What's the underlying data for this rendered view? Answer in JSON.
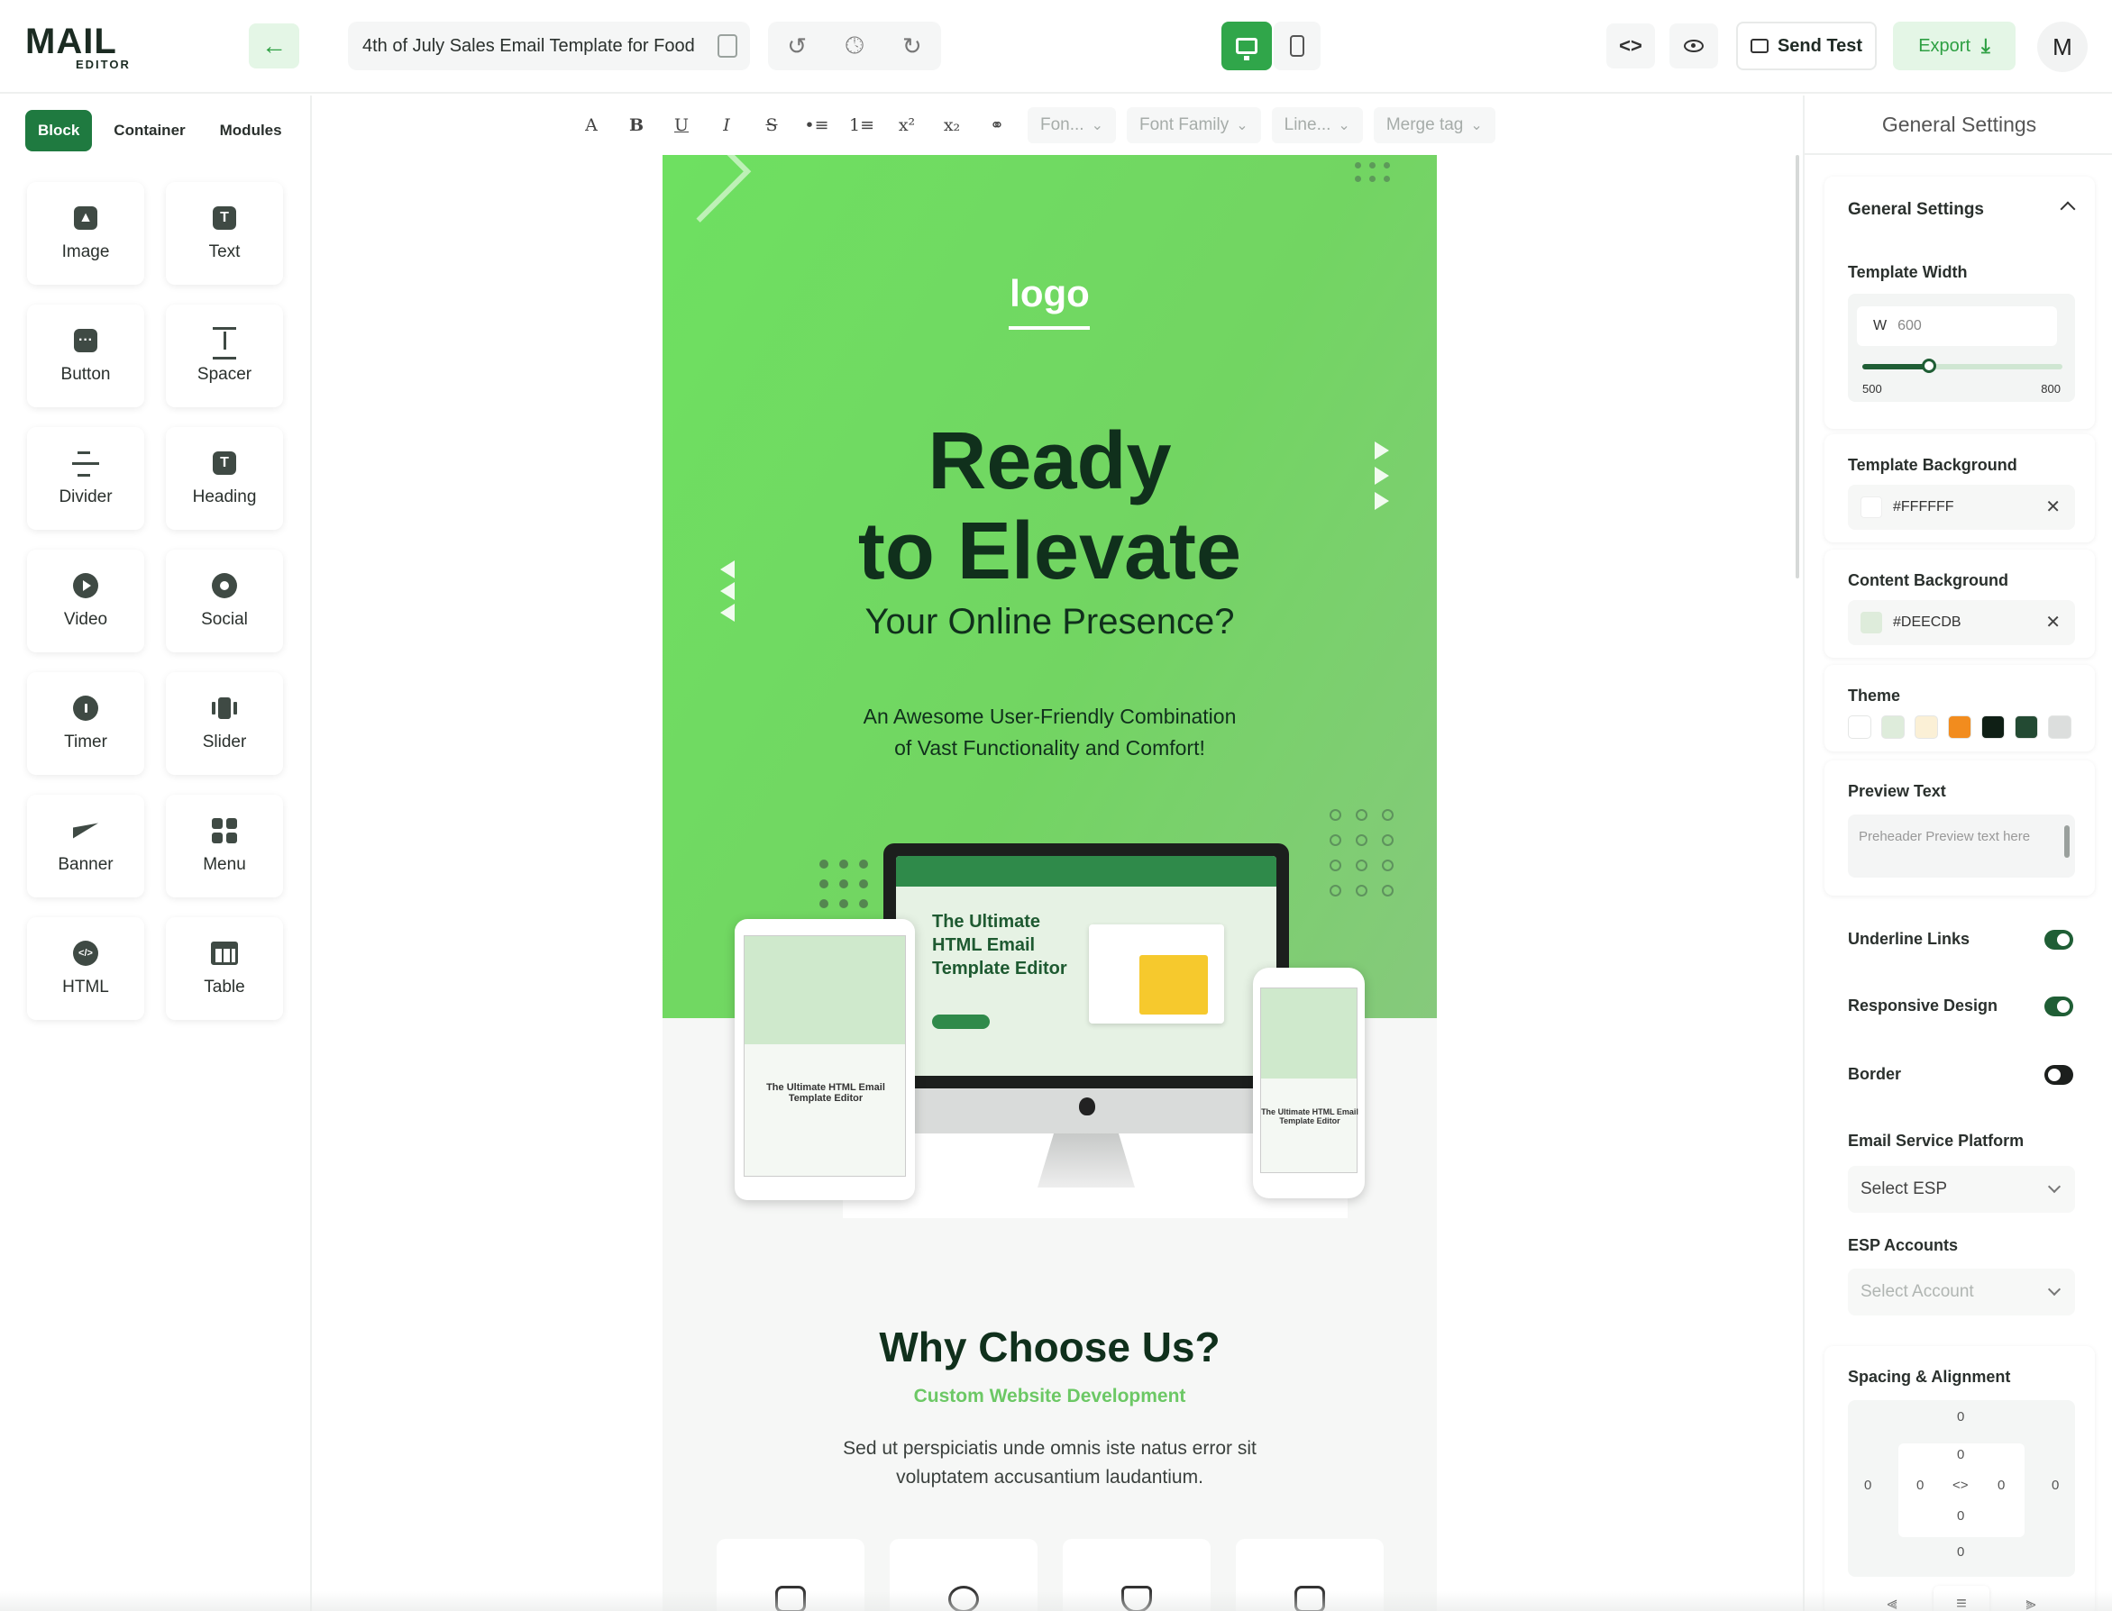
{
  "app": {
    "logo_main": "MAIL",
    "logo_sub": "EDITOR",
    "template_title": "4th of July Sales Email Template for Food",
    "send_test_label": "Send Test",
    "export_label": "Export",
    "avatar_initial": "M"
  },
  "sidebar": {
    "tabs": [
      {
        "label": "Block",
        "active": true
      },
      {
        "label": "Container",
        "active": false
      },
      {
        "label": "Modules",
        "active": false
      }
    ],
    "blocks": [
      {
        "label": "Image",
        "icon": "image-icon"
      },
      {
        "label": "Text",
        "icon": "text-icon"
      },
      {
        "label": "Button",
        "icon": "button-icon"
      },
      {
        "label": "Spacer",
        "icon": "spacer-icon"
      },
      {
        "label": "Divider",
        "icon": "divider-icon"
      },
      {
        "label": "Heading",
        "icon": "heading-icon"
      },
      {
        "label": "Video",
        "icon": "video-icon"
      },
      {
        "label": "Social",
        "icon": "social-icon"
      },
      {
        "label": "Timer",
        "icon": "timer-icon"
      },
      {
        "label": "Slider",
        "icon": "slider-icon"
      },
      {
        "label": "Banner",
        "icon": "banner-icon"
      },
      {
        "label": "Menu",
        "icon": "menu-icon"
      },
      {
        "label": "HTML",
        "icon": "html-icon"
      },
      {
        "label": "Table",
        "icon": "table-icon"
      }
    ]
  },
  "format_toolbar": {
    "buttons": [
      "A",
      "B",
      "U",
      "I",
      "S",
      "•≡",
      "1≡",
      "x²",
      "x₂",
      "⚭"
    ],
    "font_size_placeholder": "Fon...",
    "font_family_placeholder": "Font Family",
    "line_height_placeholder": "Line...",
    "merge_tag_placeholder": "Merge tag"
  },
  "email": {
    "logo_text": "logo",
    "headline_line1": "Ready",
    "headline_line2": "to Elevate",
    "subheadline": "Your Online Presence?",
    "tagline_line1": "An Awesome User-Friendly Combination",
    "tagline_line2": "of Vast Functionality and Comfort!",
    "mock_title_line1": "The Ultimate",
    "mock_title_line2": "HTML Email",
    "mock_title_line3": "Template Editor",
    "tablet_text": "The Ultimate HTML Email Template Editor",
    "phone_text": "The Ultimate HTML Email Template Editor",
    "why_title": "Why Choose Us?",
    "why_subtitle": "Custom Website Development",
    "why_text_line1": "Sed ut perspiciatis unde omnis iste natus error sit",
    "why_text_line2": "voluptatem accusantium laudantium.",
    "hero_color": "#72D562"
  },
  "settings": {
    "panel_title": "General Settings",
    "section_title": "General Settings",
    "template_width_label": "Template Width",
    "width_prefix": "W",
    "width_value": "600",
    "width_min": "500",
    "width_max": "800",
    "width_fraction": 0.333,
    "template_background_label": "Template Background",
    "template_background_value": "#FFFFFF",
    "content_background_label": "Content Background",
    "content_background_value": "#DEECDB",
    "theme_label": "Theme",
    "theme_colors": [
      "#FFFFFF",
      "#DEECDB",
      "#FBF0D6",
      "#F28C1E",
      "#0F1F15",
      "#234A33",
      "#DCDEDD"
    ],
    "preview_text_label": "Preview Text",
    "preview_text_placeholder": "Preheader Preview text here",
    "underline_links_label": "Underline Links",
    "underline_links_on": true,
    "responsive_design_label": "Responsive Design",
    "responsive_design_on": true,
    "border_label": "Border",
    "border_on": false,
    "esp_label": "Email Service Platform",
    "esp_placeholder": "Select ESP",
    "esp_accounts_label": "ESP Accounts",
    "esp_accounts_placeholder": "Select Account",
    "spacing_label": "Spacing & Alignment",
    "spacing_values": {
      "outer_top": "0",
      "inner_top": "0",
      "outer_left": "0",
      "inner_left": "0",
      "inner_right": "0",
      "outer_right": "0",
      "inner_bottom": "0",
      "outer_bottom": "0"
    }
  }
}
